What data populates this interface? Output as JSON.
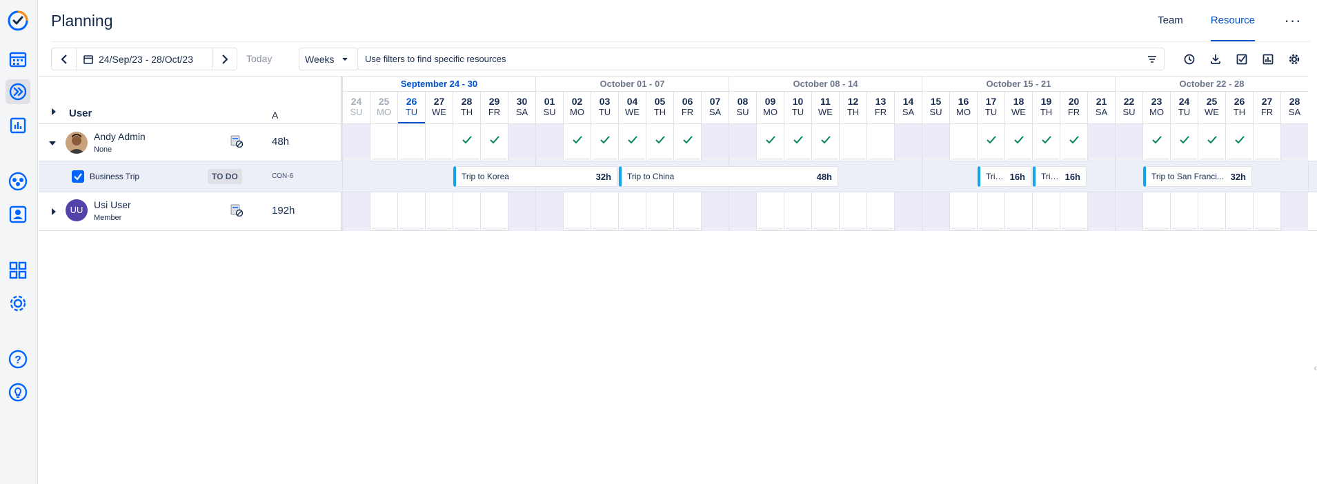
{
  "sidebar": {
    "items": [
      {
        "name": "app-logo-icon"
      },
      {
        "name": "calendar-icon"
      },
      {
        "name": "planning-icon",
        "active": true
      },
      {
        "name": "reports-icon"
      },
      {
        "name": "teams-icon"
      },
      {
        "name": "resource-icon"
      },
      {
        "name": "dashboard-icon"
      },
      {
        "name": "settings-icon"
      },
      {
        "name": "help-icon"
      },
      {
        "name": "ideas-icon"
      }
    ]
  },
  "header": {
    "title": "Planning",
    "tabs": [
      {
        "label": "Team",
        "active": false
      },
      {
        "label": "Resource",
        "active": true
      }
    ],
    "more_label": "···"
  },
  "toolbar": {
    "date_range": "24/Sep/23 - 28/Oct/23",
    "today_label": "Today",
    "view_select": "Weeks",
    "filter_placeholder": "Use filters to find specific resources"
  },
  "grid": {
    "user_col_label": "User",
    "hours_col_label": "A",
    "weeks": [
      {
        "label": "September 24 - 30",
        "current": true
      },
      {
        "label": "October 01 - 07",
        "current": false
      },
      {
        "label": "October 08 - 14",
        "current": false
      },
      {
        "label": "October 15 - 21",
        "current": false
      },
      {
        "label": "October 22 - 28",
        "current": false
      }
    ],
    "days": [
      {
        "d": "24",
        "w": "SU",
        "state": "past",
        "weekend": true
      },
      {
        "d": "25",
        "w": "MO",
        "state": "past",
        "weekend": false
      },
      {
        "d": "26",
        "w": "TU",
        "state": "today",
        "weekend": false
      },
      {
        "d": "27",
        "w": "WE",
        "state": "",
        "weekend": false
      },
      {
        "d": "28",
        "w": "TH",
        "state": "",
        "weekend": false
      },
      {
        "d": "29",
        "w": "FR",
        "state": "",
        "weekend": false
      },
      {
        "d": "30",
        "w": "SA",
        "state": "",
        "weekend": true
      },
      {
        "d": "01",
        "w": "SU",
        "state": "",
        "weekend": true
      },
      {
        "d": "02",
        "w": "MO",
        "state": "",
        "weekend": false
      },
      {
        "d": "03",
        "w": "TU",
        "state": "",
        "weekend": false
      },
      {
        "d": "04",
        "w": "WE",
        "state": "",
        "weekend": false
      },
      {
        "d": "05",
        "w": "TH",
        "state": "",
        "weekend": false
      },
      {
        "d": "06",
        "w": "FR",
        "state": "",
        "weekend": false
      },
      {
        "d": "07",
        "w": "SA",
        "state": "",
        "weekend": true
      },
      {
        "d": "08",
        "w": "SU",
        "state": "",
        "weekend": true
      },
      {
        "d": "09",
        "w": "MO",
        "state": "",
        "weekend": false
      },
      {
        "d": "10",
        "w": "TU",
        "state": "",
        "weekend": false
      },
      {
        "d": "11",
        "w": "WE",
        "state": "",
        "weekend": false
      },
      {
        "d": "12",
        "w": "TH",
        "state": "",
        "weekend": false
      },
      {
        "d": "13",
        "w": "FR",
        "state": "",
        "weekend": false
      },
      {
        "d": "14",
        "w": "SA",
        "state": "",
        "weekend": true
      },
      {
        "d": "15",
        "w": "SU",
        "state": "",
        "weekend": true
      },
      {
        "d": "16",
        "w": "MO",
        "state": "",
        "weekend": false
      },
      {
        "d": "17",
        "w": "TU",
        "state": "",
        "weekend": false
      },
      {
        "d": "18",
        "w": "WE",
        "state": "",
        "weekend": false
      },
      {
        "d": "19",
        "w": "TH",
        "state": "",
        "weekend": false
      },
      {
        "d": "20",
        "w": "FR",
        "state": "",
        "weekend": false
      },
      {
        "d": "21",
        "w": "SA",
        "state": "",
        "weekend": true
      },
      {
        "d": "22",
        "w": "SU",
        "state": "",
        "weekend": true
      },
      {
        "d": "23",
        "w": "MO",
        "state": "",
        "weekend": false
      },
      {
        "d": "24",
        "w": "TU",
        "state": "",
        "weekend": false
      },
      {
        "d": "25",
        "w": "WE",
        "state": "",
        "weekend": false
      },
      {
        "d": "26",
        "w": "TH",
        "state": "",
        "weekend": false
      },
      {
        "d": "27",
        "w": "FR",
        "state": "",
        "weekend": false
      },
      {
        "d": "28",
        "w": "SA",
        "state": "",
        "weekend": true
      }
    ]
  },
  "rows": {
    "andy": {
      "name": "Andy Admin",
      "role": "None",
      "hours": "48h",
      "check_days": [
        4,
        5,
        8,
        9,
        10,
        11,
        12,
        15,
        16,
        17,
        23,
        24,
        25,
        26,
        29,
        30,
        31,
        32
      ]
    },
    "task": {
      "title": "Business Trip",
      "status": "TO DO",
      "key": "CON-6",
      "trips": [
        {
          "name": "Trip to Korea",
          "hours": "32h",
          "start": 4,
          "days": 6
        },
        {
          "name": "Trip to China",
          "hours": "48h",
          "start": 10,
          "days": 8
        },
        {
          "name": "Trip...",
          "hours": "16h",
          "start": 23,
          "days": 2
        },
        {
          "name": "Trip...",
          "hours": "16h",
          "start": 25,
          "days": 2
        },
        {
          "name": "Trip to San Franci...",
          "hours": "32h",
          "start": 29,
          "days": 4
        }
      ]
    },
    "usi": {
      "name": "Usi User",
      "role": "Member",
      "hours": "192h",
      "initials": "UU"
    }
  },
  "colors": {
    "accent": "#0052cc",
    "check": "#00875a",
    "trip_bar": "#0ea5e9",
    "weekend": "#ebecf7",
    "avatar_uu": "#5243aa"
  }
}
